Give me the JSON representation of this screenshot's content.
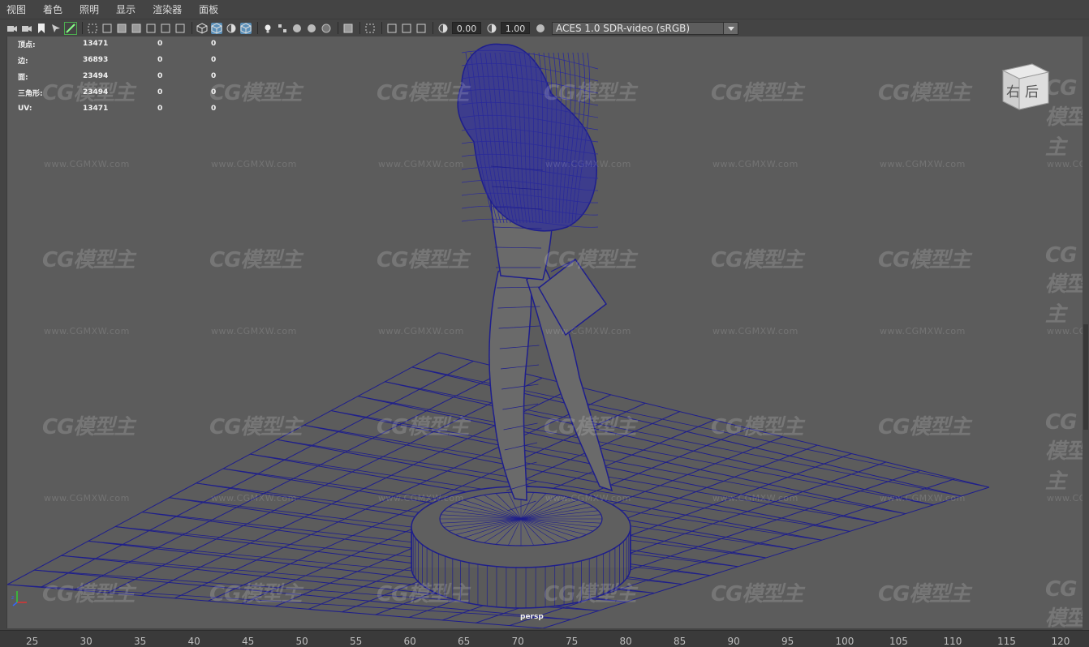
{
  "menu": [
    "视图",
    "着色",
    "照明",
    "显示",
    "渲染器",
    "面板"
  ],
  "toolbar": {
    "field_a": "0.00",
    "field_b": "1.00",
    "colorspace": "ACES 1.0 SDR-video (sRGB)",
    "icons": [
      "camera-icon",
      "camera-attr-icon",
      "bookmark-icon",
      "snap-icon",
      "pen-icon",
      "grid-icon",
      "film-gate-icon",
      "resolution-gate-icon",
      "gate-mask-icon",
      "field-chart-icon",
      "safe-action-icon",
      "safe-title-icon",
      "wireframe-icon",
      "smooth-shade-icon",
      "default-material-icon",
      "textured-icon",
      "use-all-lights-icon",
      "shadows-icon",
      "screen-space-ao-icon",
      "motion-blur-icon",
      "anti-alias-icon",
      "depth-of-field-icon",
      "isolate-select-icon",
      "xray-icon",
      "xray-joints-icon",
      "backface-icon",
      "exposure-icon",
      "gamma-icon",
      "color-management-icon"
    ]
  },
  "hud": {
    "rows": [
      {
        "label": "顶点:",
        "value": "13471",
        "a": "0",
        "b": "0"
      },
      {
        "label": "边:",
        "value": "36893",
        "a": "0",
        "b": "0"
      },
      {
        "label": "面:",
        "value": "23494",
        "a": "0",
        "b": "0"
      },
      {
        "label": "三角形:",
        "value": "23494",
        "a": "0",
        "b": "0"
      },
      {
        "label": "UV:",
        "value": "13471",
        "a": "0",
        "b": "0"
      }
    ]
  },
  "viewcube_label": "右后",
  "camera": "persp",
  "timeline_ticks": [
    "25",
    "30",
    "35",
    "40",
    "45",
    "50",
    "55",
    "60",
    "65",
    "70",
    "75",
    "80",
    "85",
    "90",
    "95",
    "100",
    "105",
    "110",
    "115",
    "120"
  ],
  "watermark": {
    "logo": "CG模型主",
    "url": "www.CGMXW.com"
  },
  "colors": {
    "wire": "#1e1e8c",
    "viewport_bg": "#5c5c5c",
    "active_icon": "#5a8fb8"
  }
}
